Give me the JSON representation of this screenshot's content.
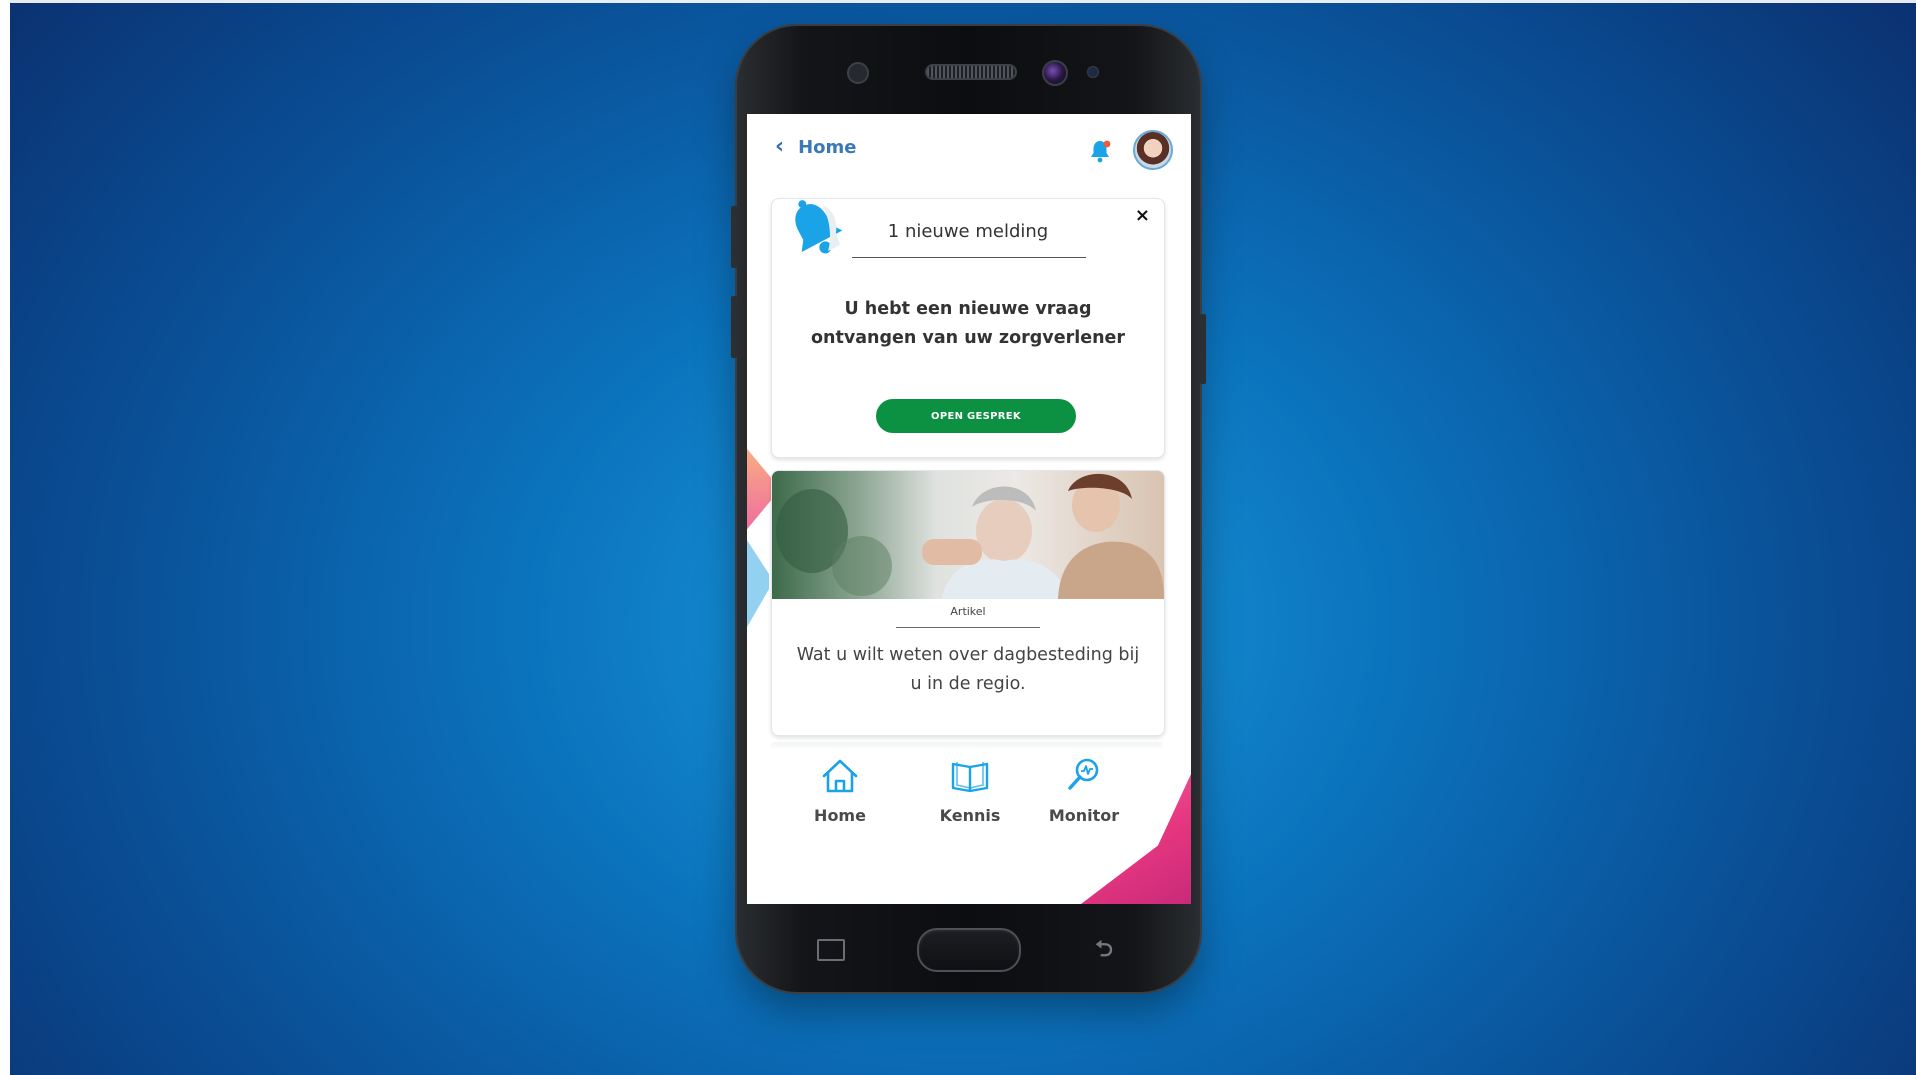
{
  "header": {
    "back_label": "Home",
    "notification_icon": "bell-icon",
    "avatar": "user-avatar"
  },
  "notification": {
    "title": "1 nieuwe melding",
    "message": "U hebt een nieuwe vraag ontvangen van uw zorgverlener",
    "button_label": "OPEN GESPREK",
    "close_label": "×",
    "icon": "bell-icon"
  },
  "article": {
    "tag": "Artikel",
    "title": "Wat u wilt weten over dagbesteding bij u in de regio.",
    "image": "elderly-woman-with-caregiver-photo"
  },
  "nav": {
    "items": [
      {
        "label": "Home",
        "icon": "home-icon"
      },
      {
        "label": "Kennis",
        "icon": "book-icon"
      },
      {
        "label": "Monitor",
        "icon": "monitor-icon"
      }
    ]
  },
  "colors": {
    "primary_blue": "#2f6fb1",
    "icon_blue": "#1aa3e6",
    "button_green": "#0c9142",
    "accent_pink": "#e6367f"
  }
}
